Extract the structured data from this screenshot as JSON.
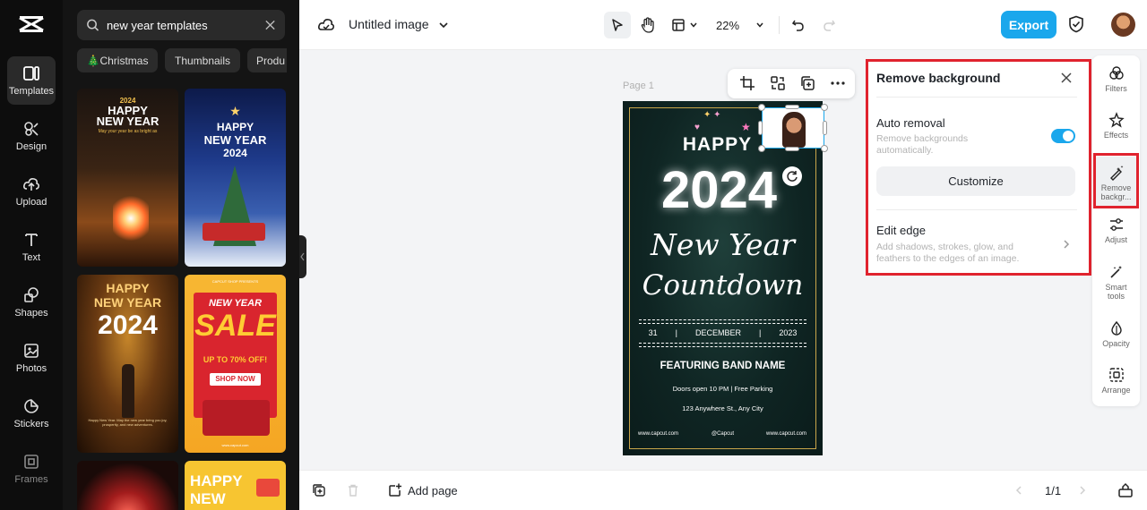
{
  "rail": {
    "items": [
      {
        "label": "Templates"
      },
      {
        "label": "Design"
      },
      {
        "label": "Upload"
      },
      {
        "label": "Text"
      },
      {
        "label": "Shapes"
      },
      {
        "label": "Photos"
      },
      {
        "label": "Stickers"
      },
      {
        "label": "Frames"
      }
    ]
  },
  "panel": {
    "search_value": "new year templates",
    "chips": [
      "🎄Christmas",
      "Thumbnails",
      "Produ"
    ],
    "thumbs": [
      {
        "line1": "2024",
        "line2": "HAPPY",
        "line3": "NEW YEAR",
        "line4": "May your year be as bright as"
      },
      {
        "line1": "HAPPY",
        "line2": "NEW YEAR",
        "line3": "2024"
      },
      {
        "line1": "HAPPY",
        "line2": "NEW YEAR",
        "line3": "2024",
        "line4": "Happy New Year. May the new year bring you joy, prosperity, and new adventures."
      },
      {
        "line0": "CAPCUT SHOP PRESENTS",
        "line1": "NEW YEAR",
        "line2": "SALE",
        "line3": "UP TO 70% OFF!",
        "line4": "SHOP NOW",
        "line5": "www.capcut.com"
      },
      {
        "line1": ""
      },
      {
        "line1": "HAPPY",
        "line2": "NEW"
      }
    ]
  },
  "topbar": {
    "title": "Untitled image",
    "zoom": "22%",
    "export_label": "Export"
  },
  "canvas": {
    "page_label": "Page 1",
    "poster": {
      "happy": "HAPPY",
      "year": "2024",
      "script1": "New Year",
      "script2": "Countdown",
      "date_day": "31",
      "sep": "|",
      "date_month": "DECEMBER",
      "date_year": "2023",
      "band": "FEATURING BAND NAME",
      "doors": "Doors open 10 PM | Free Parking",
      "address": "123 Anywhere St., Any City",
      "foot_left": "www.capcut.com",
      "foot_mid": "@Capcut",
      "foot_right": "www.capcut.com"
    }
  },
  "remove_bg": {
    "title": "Remove background",
    "auto_title": "Auto removal",
    "auto_sub1": "Remove backgrounds",
    "auto_sub2": "automatically.",
    "customize": "Customize",
    "edge_title": "Edit edge",
    "edge_sub1": "Add shadows, strokes, glow, and",
    "edge_sub2": "feathers to the edges of an image.",
    "auto_on": true
  },
  "rtools": [
    {
      "label": "Filters"
    },
    {
      "label": "Effects"
    },
    {
      "label1": "Remove",
      "label2": "backgr..."
    },
    {
      "label": "Adjust"
    },
    {
      "label1": "Smart",
      "label2": "tools"
    },
    {
      "label": "Opacity"
    },
    {
      "label": "Arrange"
    }
  ],
  "bottombar": {
    "add_page": "Add page",
    "page_count": "1/1"
  },
  "colors": {
    "accent": "#1aa7ec",
    "highlight": "#e0232e",
    "rail_bg": "#0d0d0d",
    "panel_bg": "#141414"
  }
}
